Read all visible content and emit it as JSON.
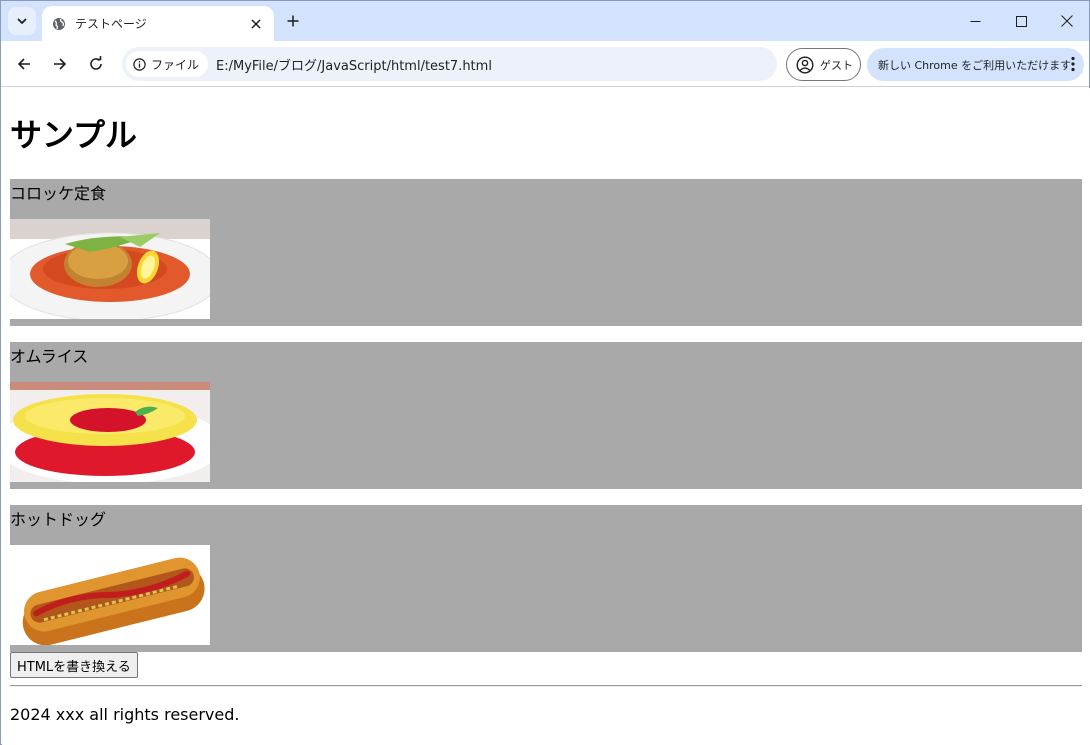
{
  "browser": {
    "tab_title": "テストページ",
    "address_chip": "ファイル",
    "url": "E:/MyFile/ブログ/JavaScript/html/test7.html",
    "profile_label": "ゲスト",
    "promo_label": "新しい Chrome をご利用いただけます",
    "icons": [
      "tab-search-icon",
      "globe-icon",
      "close-icon",
      "plus-icon",
      "minimize-icon",
      "maximize-icon",
      "close-window-icon",
      "back-arrow-icon",
      "forward-arrow-icon",
      "reload-icon",
      "info-icon",
      "profile-icon",
      "kebab-menu-icon"
    ]
  },
  "page": {
    "heading": "サンプル",
    "items": [
      {
        "name": "コロッケ定食",
        "image": "croquette-plate-photo"
      },
      {
        "name": "オムライス",
        "image": "omurice-photo"
      },
      {
        "name": "ホットドッグ",
        "image": "hotdog-photo"
      }
    ],
    "button_label": "HTMLを書き換える",
    "footer": "2024 xxx all rights reserved."
  },
  "colors": {
    "tabstrip": "#d3e3fd",
    "item_background": "#a9a9a9",
    "omnibox": "#edf2fa"
  }
}
